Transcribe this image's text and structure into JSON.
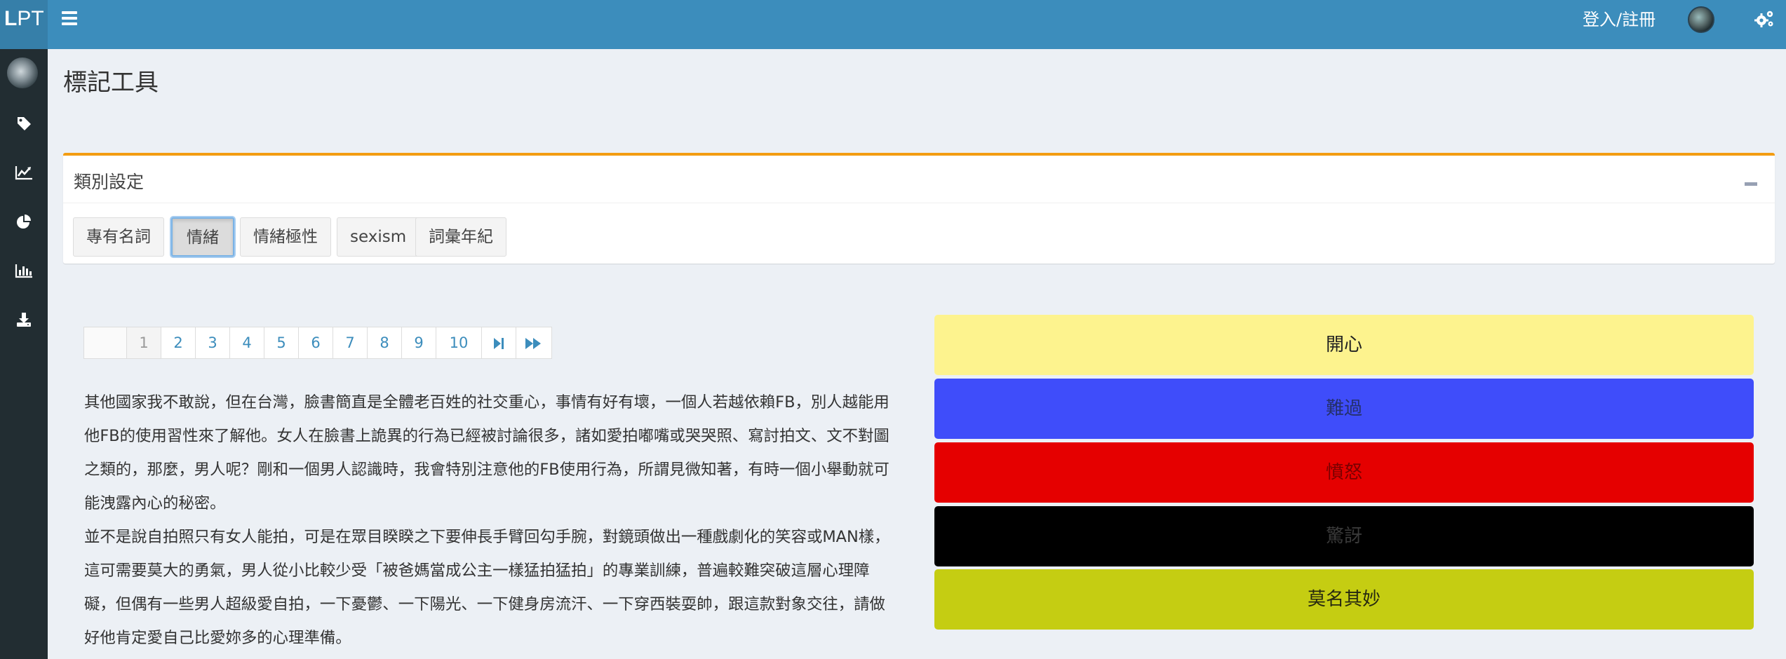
{
  "header": {
    "logo_bold": "L",
    "logo_rest": "PT",
    "login_label": "登入/註冊"
  },
  "sidebar": {
    "items": [
      {
        "icon": "tag-icon"
      },
      {
        "icon": "line-chart-icon"
      },
      {
        "icon": "pie-chart-icon"
      },
      {
        "icon": "bar-chart-icon"
      },
      {
        "icon": "download-icon"
      }
    ]
  },
  "page": {
    "title": "標記工具"
  },
  "category_box": {
    "title": "類別設定",
    "accent_color": "#f39c12",
    "buttons": [
      {
        "label": "專有名詞",
        "active": false
      },
      {
        "label": "情緒",
        "active": true
      },
      {
        "label": "情緒極性",
        "active": false
      },
      {
        "label": "sexism",
        "active": false
      },
      {
        "label": "詞彙年紀",
        "active": false
      }
    ]
  },
  "pagination": {
    "pages": [
      "1",
      "2",
      "3",
      "4",
      "5",
      "6",
      "7",
      "8",
      "9",
      "10"
    ],
    "current": "1"
  },
  "article": {
    "paragraphs": [
      "其他國家我不敢說，但在台灣，臉書簡直是全體老百姓的社交重心，事情有好有壞，一個人若越依賴FB，別人越能用他FB的使用習性來了解他。女人在臉書上詭異的行為已經被討論很多，諸如愛拍嘟嘴或哭哭照、寫討拍文、文不對圖之類的，那麼，男人呢？剛和一個男人認識時，我會特別注意他的FB使用行為，所謂見微知著，有時一個小舉動就可能洩露內心的秘密。",
      "並不是說自拍照只有女人能拍，可是在眾目睽睽之下要伸長手臂回勾手腕，對鏡頭做出一種戲劇化的笑容或MAN樣，這可需要莫大的勇氣，男人從小比較少受「被爸媽當成公主一樣猛拍猛拍」的專業訓練，普遍較難突破這層心理障礙，但偶有一些男人超級愛自拍，一下憂鬱、一下陽光、一下健身房流汗、一下穿西裝耍帥，跟這款對象交往，請做好他肯定愛自己比愛妳多的心理準備。"
    ]
  },
  "emotions": [
    {
      "label": "開心",
      "bg": "#fdf38e",
      "fg": "#222222"
    },
    {
      "label": "難過",
      "bg": "#3f4dfa",
      "fg": "#25306a"
    },
    {
      "label": "憤怒",
      "bg": "#e50000",
      "fg": "#7a0000"
    },
    {
      "label": "驚訝",
      "bg": "#000000",
      "fg": "#3a3a3a"
    },
    {
      "label": "莫名其妙",
      "bg": "#c5cd12",
      "fg": "#262810"
    }
  ]
}
